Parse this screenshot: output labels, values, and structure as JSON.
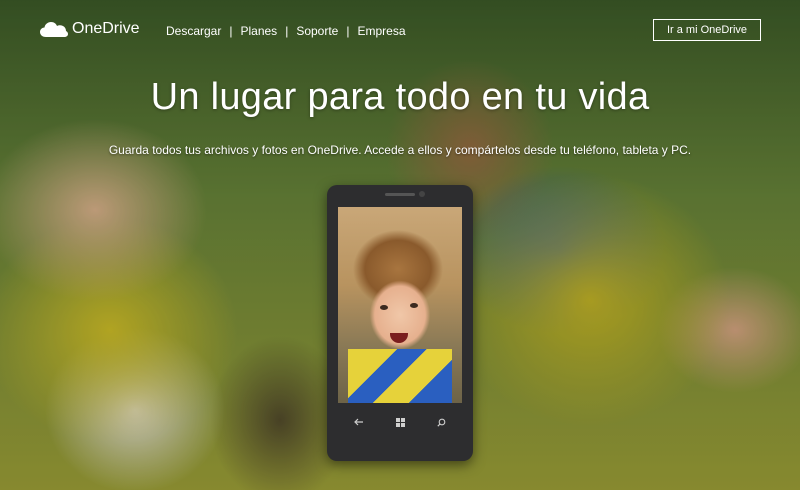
{
  "header": {
    "logo_text": "OneDrive",
    "nav": [
      {
        "label": "Descargar"
      },
      {
        "label": "Planes"
      },
      {
        "label": "Soporte"
      },
      {
        "label": "Empresa"
      }
    ],
    "cta_label": "Ir a mi OneDrive"
  },
  "hero": {
    "headline": "Un lugar para todo en tu vida",
    "subhead": "Guarda todos tus archivos y fotos en OneDrive. Accede a ellos y compártelos desde tu teléfono, tableta y PC."
  },
  "phone": {
    "buttons": [
      "back-icon",
      "windows-icon",
      "search-icon"
    ]
  },
  "colors": {
    "text": "#ffffff",
    "phone_body": "#2d2d2f"
  }
}
